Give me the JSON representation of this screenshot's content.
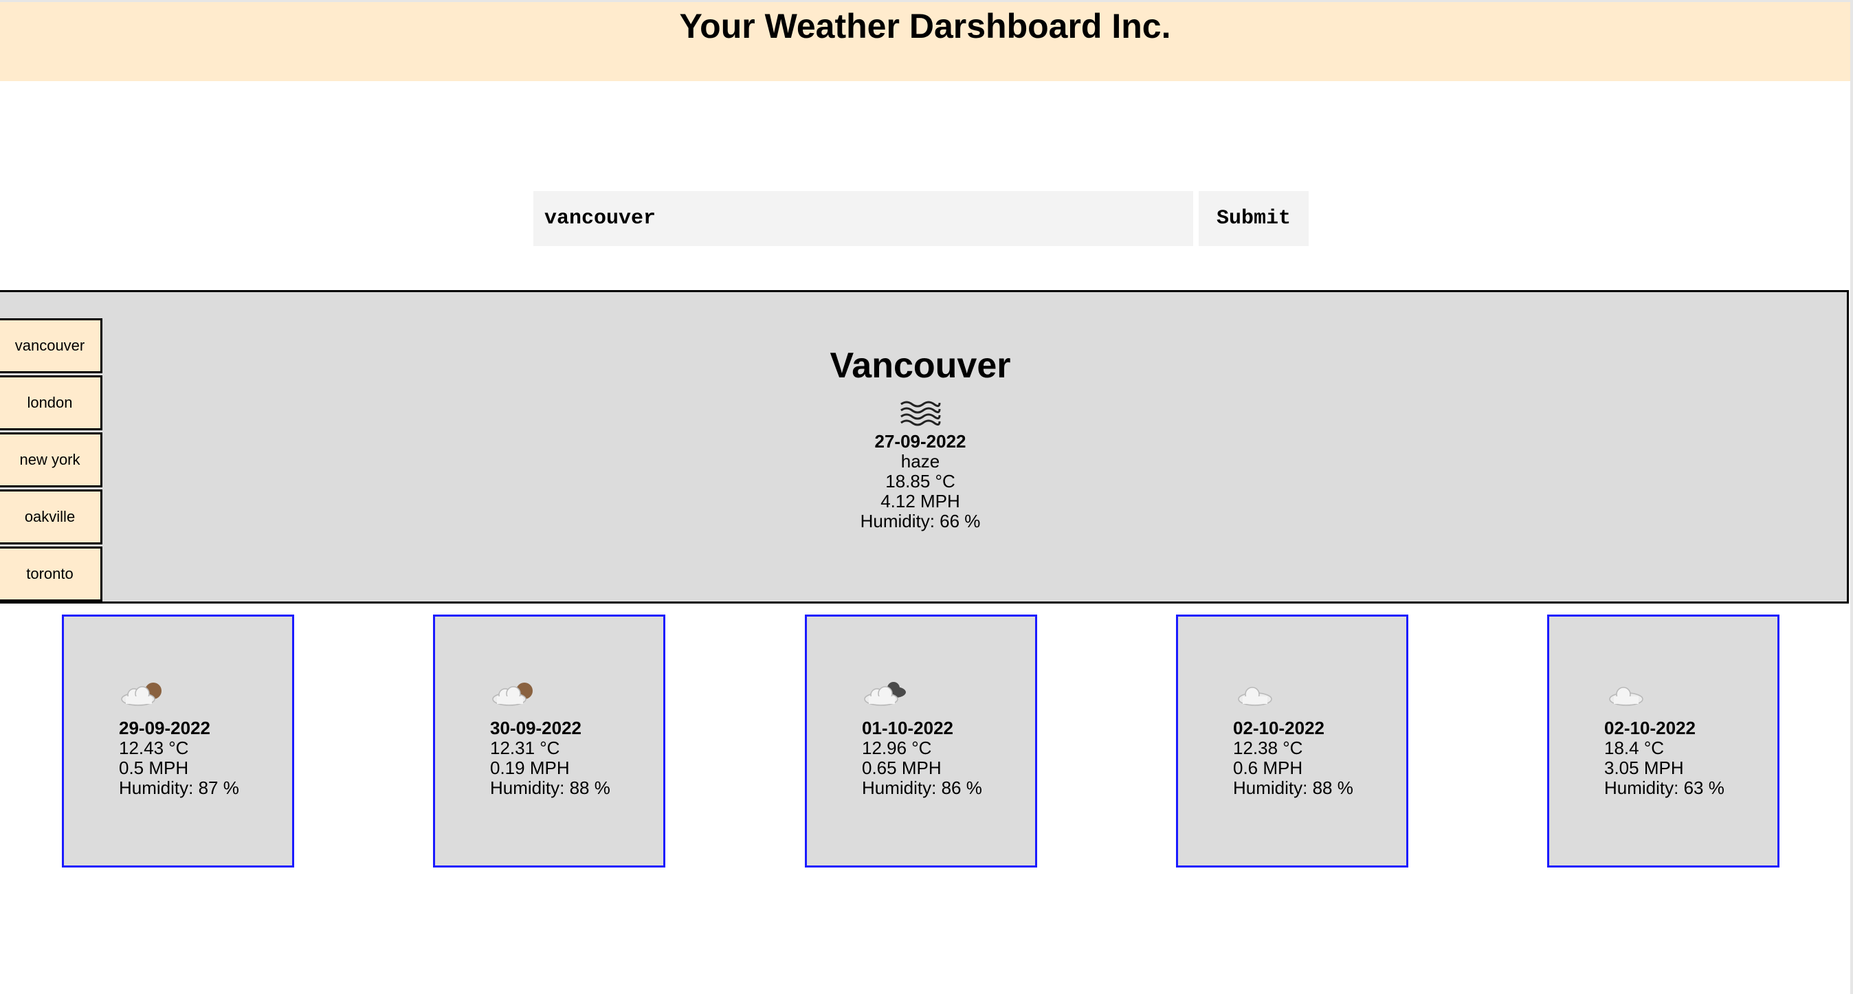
{
  "header": {
    "title": "Your Weather Darshboard Inc."
  },
  "search": {
    "value": "vancouver",
    "submit_label": "Submit"
  },
  "history": [
    "vancouver",
    "london",
    "new york",
    "oakville",
    "toronto"
  ],
  "current": {
    "city": "Vancouver",
    "icon": "haze-icon",
    "date": "27-09-2022",
    "description": "haze",
    "temp": "18.85 °C",
    "wind": "4.12 MPH",
    "humidity": "Humidity: 66 %"
  },
  "forecast": [
    {
      "icon": "partly-cloudy-icon",
      "date": "29-09-2022",
      "temp": "12.43 °C",
      "wind": "0.5 MPH",
      "humidity": "Humidity: 87 %"
    },
    {
      "icon": "partly-cloudy-icon",
      "date": "30-09-2022",
      "temp": "12.31 °C",
      "wind": "0.19 MPH",
      "humidity": "Humidity: 88 %"
    },
    {
      "icon": "broken-clouds-icon",
      "date": "01-10-2022",
      "temp": "12.96 °C",
      "wind": "0.65 MPH",
      "humidity": "Humidity: 86 %"
    },
    {
      "icon": "cloud-icon",
      "date": "02-10-2022",
      "temp": "12.38 °C",
      "wind": "0.6 MPH",
      "humidity": "Humidity: 88 %"
    },
    {
      "icon": "cloud-icon",
      "date": "02-10-2022",
      "temp": "18.4 °C",
      "wind": "3.05 MPH",
      "humidity": "Humidity: 63 %"
    }
  ],
  "colors": {
    "header_bg": "#ffebcd",
    "panel_bg": "#dcdcdc",
    "card_border": "#1a1aff"
  }
}
